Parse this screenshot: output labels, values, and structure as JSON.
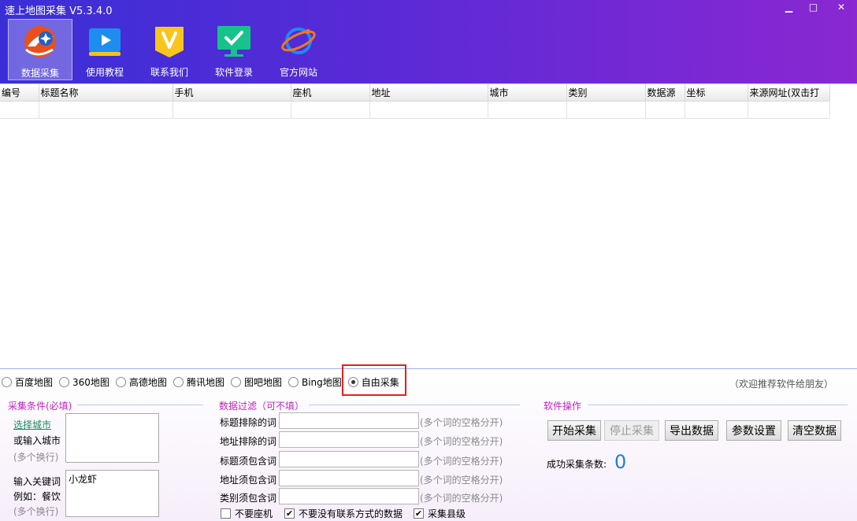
{
  "window": {
    "title": "速上地图采集 V5.3.4.0",
    "min_glyph": "▁",
    "max_glyph": "□",
    "close_glyph": "✕"
  },
  "toolbar": {
    "items": [
      {
        "label": "数据采集",
        "icon": "satellite-logo-icon"
      },
      {
        "label": "使用教程",
        "icon": "play-tutorial-icon"
      },
      {
        "label": "联系我们",
        "icon": "v-contact-icon"
      },
      {
        "label": "软件登录",
        "icon": "monitor-check-icon"
      },
      {
        "label": "官方网站",
        "icon": "planet-icon"
      }
    ]
  },
  "table": {
    "columns": [
      "编号",
      "标题名称",
      "手机",
      "座机",
      "地址",
      "城市",
      "类别",
      "数据源",
      "坐标",
      "来源网址(双击打"
    ]
  },
  "sources": {
    "options": [
      "百度地图",
      "360地图",
      "高德地图",
      "腾讯地图",
      "图吧地图",
      "Bing地图",
      "自由采集"
    ],
    "selected": "自由采集",
    "recommend": "（欢迎推荐软件给朋友）"
  },
  "conditions": {
    "title": "采集条件(必填)",
    "select_city": "选择城市",
    "or_input_city": "或输入城市",
    "multi_line_1": "(多个换行)",
    "keyword_label": "输入关键词",
    "keyword_example": "例如：餐饮",
    "multi_line_2": "(多个换行)",
    "city_value": "",
    "keyword_value": "小龙虾"
  },
  "filter": {
    "title": "数据过滤（可不填）",
    "rows": [
      {
        "label": "标题排除的词",
        "hint": "(多个词的空格分开)"
      },
      {
        "label": "地址排除的词",
        "hint": "(多个词的空格分开)"
      },
      {
        "label": "标题须包含词",
        "hint": "(多个词的空格分开)"
      },
      {
        "label": "地址须包含词",
        "hint": "(多个词的空格分开)"
      },
      {
        "label": "类别须包含词",
        "hint": "(多个词的空格分开)"
      }
    ],
    "checks": [
      {
        "label": "不要座机",
        "checked": false
      },
      {
        "label": "不要没有联系方式的数据",
        "checked": true
      },
      {
        "label": "采集县级",
        "checked": true
      }
    ]
  },
  "ops": {
    "title": "软件操作",
    "buttons": {
      "start": "开始采集",
      "stop": "停止采集",
      "export": "导出数据",
      "settings": "参数设置",
      "clear": "清空数据"
    },
    "success_label": "成功采集条数:",
    "success_count": "0"
  },
  "colors": {
    "header_start": "#3a2fd6",
    "header_end": "#8a28d2",
    "section_title": "#c51fc5",
    "count": "#1f7fd8",
    "highlight": "#e0231b"
  }
}
